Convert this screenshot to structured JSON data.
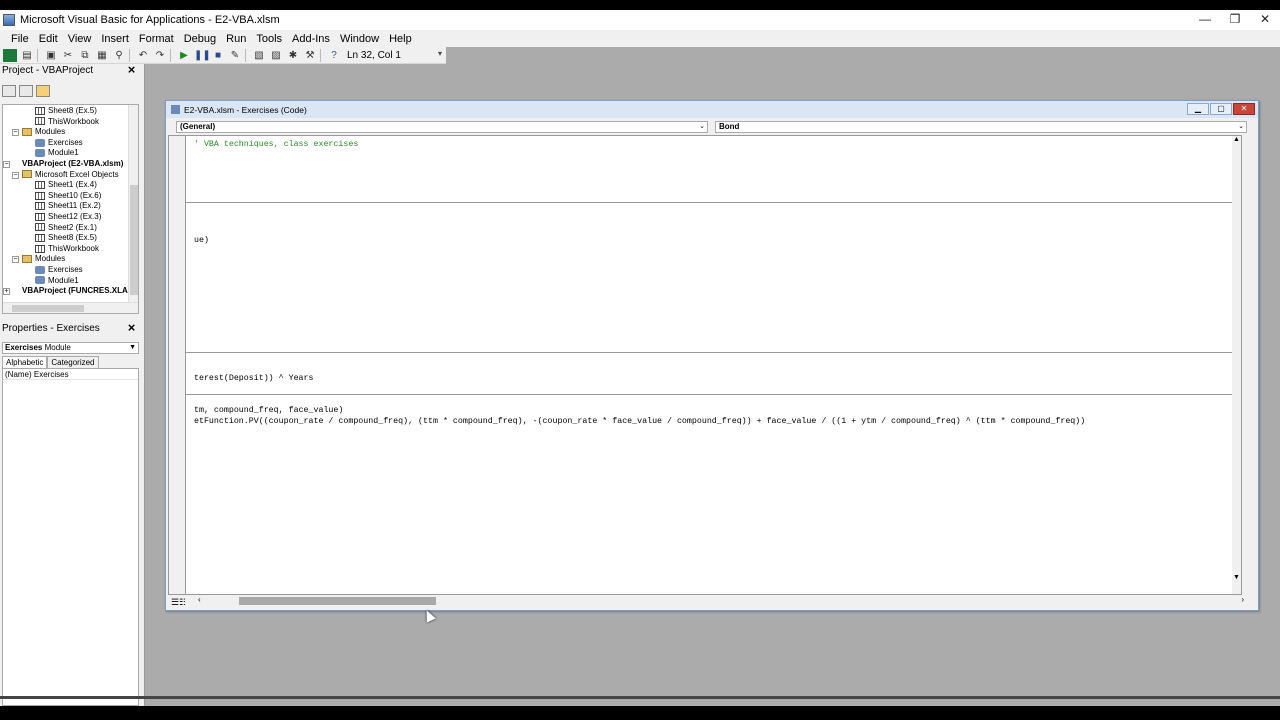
{
  "window": {
    "title": "Microsoft Visual Basic for Applications - E2-VBA.xlsm",
    "minimize": "—",
    "restore": "❐",
    "close": "✕"
  },
  "menu": [
    "File",
    "Edit",
    "View",
    "Insert",
    "Format",
    "Debug",
    "Run",
    "Tools",
    "Add-Ins",
    "Window",
    "Help"
  ],
  "toolbar": {
    "position": "Ln 32, Col 1"
  },
  "project": {
    "header": "Project - VBAProject",
    "nodes": [
      {
        "label": "Sheet8 (Ex.5)",
        "type": "sheet"
      },
      {
        "label": "ThisWorkbook",
        "type": "sheet"
      },
      {
        "label": "Modules",
        "type": "folder"
      },
      {
        "label": "Exercises",
        "type": "module"
      },
      {
        "label": "Module1",
        "type": "module"
      },
      {
        "label": "VBAProject (E2-VBA.xlsm)",
        "type": "project"
      },
      {
        "label": "Microsoft Excel Objects",
        "type": "folder"
      },
      {
        "label": "Sheet1 (Ex.4)",
        "type": "sheet"
      },
      {
        "label": "Sheet10 (Ex.6)",
        "type": "sheet"
      },
      {
        "label": "Sheet11 (Ex.2)",
        "type": "sheet"
      },
      {
        "label": "Sheet12 (Ex.3)",
        "type": "sheet"
      },
      {
        "label": "Sheet2 (Ex.1)",
        "type": "sheet"
      },
      {
        "label": "Sheet8 (Ex.5)",
        "type": "sheet"
      },
      {
        "label": "ThisWorkbook",
        "type": "sheet"
      },
      {
        "label": "Modules",
        "type": "folder"
      },
      {
        "label": "Exercises",
        "type": "module"
      },
      {
        "label": "Module1",
        "type": "module"
      },
      {
        "label": "VBAProject (FUNCRES.XLAM)",
        "type": "project"
      }
    ]
  },
  "properties": {
    "header": "Properties - Exercises",
    "object_name": "Exercises",
    "object_type": "Module",
    "tabs": [
      "Alphabetic",
      "Categorized"
    ],
    "rows": [
      "(Name) Exercises"
    ]
  },
  "code_window": {
    "title": "E2-VBA.xlsm - Exercises (Code)",
    "object_combo": "(General)",
    "proc_combo": "Bond",
    "lines": [
      {
        "text": "' VBA techniques, class exercises",
        "comment": true
      },
      {
        "text": "ue)",
        "comment": false
      },
      {
        "text": "terest(Deposit)) ^ Years",
        "comment": false
      },
      {
        "text": "tm, compound_freq, face_value)",
        "comment": false
      },
      {
        "text": "etFunction.PV((coupon_rate / compound_freq), (ttm * compound_freq), -(coupon_rate * face_value / compound_freq)) + face_value / ((1 + ytm / compound_freq) ^ (ttm * compound_freq))",
        "comment": false
      }
    ]
  },
  "colors": {
    "comment": "#2a8a2a",
    "titlebar": "#dbe6f4",
    "close": "#c8463a"
  }
}
